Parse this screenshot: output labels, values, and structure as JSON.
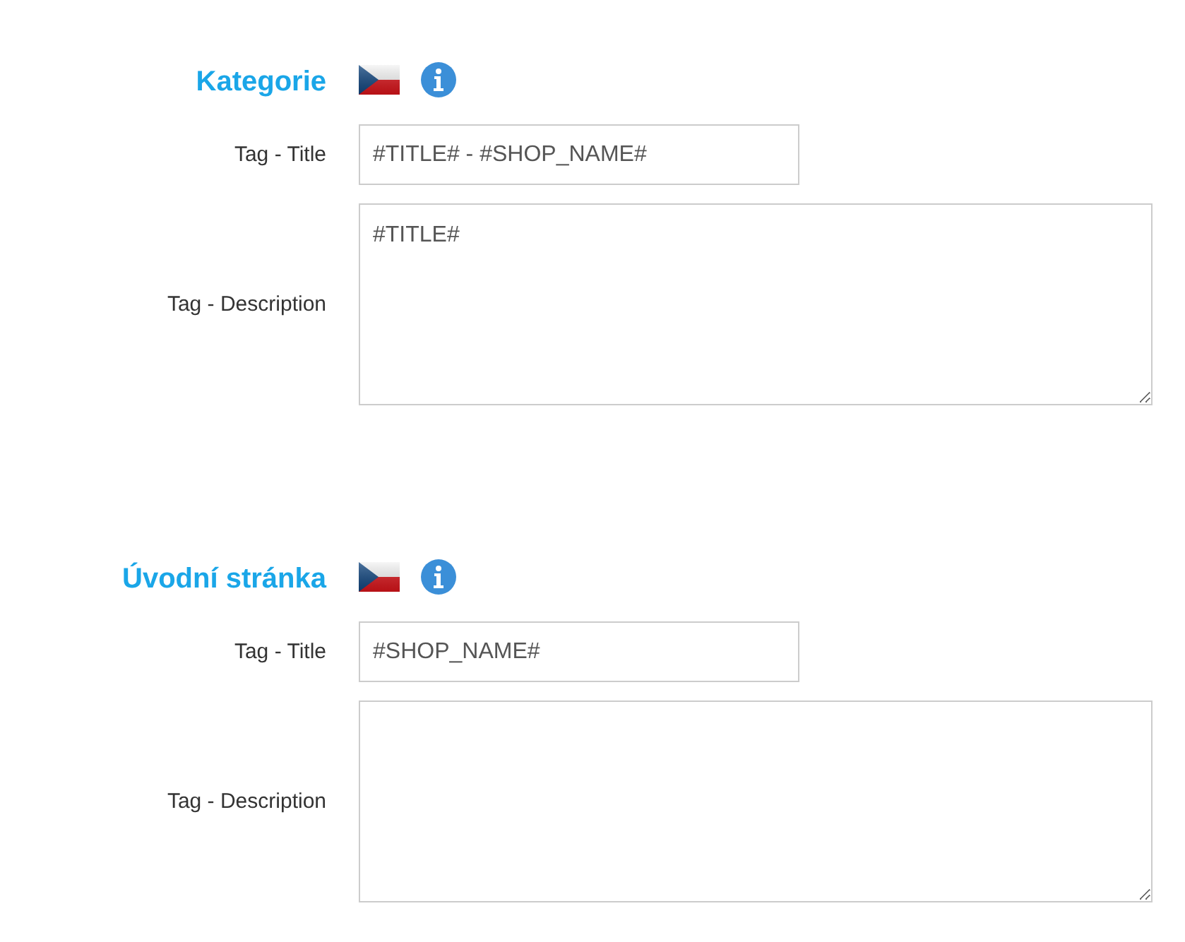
{
  "sections": [
    {
      "heading": "Kategorie",
      "fields": [
        {
          "kind": "input",
          "label": "Tag - Title",
          "value": "#TITLE# - #SHOP_NAME#"
        },
        {
          "kind": "textarea",
          "label": "Tag - Description",
          "value": "#TITLE#"
        }
      ]
    },
    {
      "heading": "Úvodní stránka",
      "fields": [
        {
          "kind": "input",
          "label": "Tag - Title",
          "value": "#SHOP_NAME#"
        },
        {
          "kind": "textarea",
          "label": "Tag - Description"
        }
      ]
    }
  ]
}
